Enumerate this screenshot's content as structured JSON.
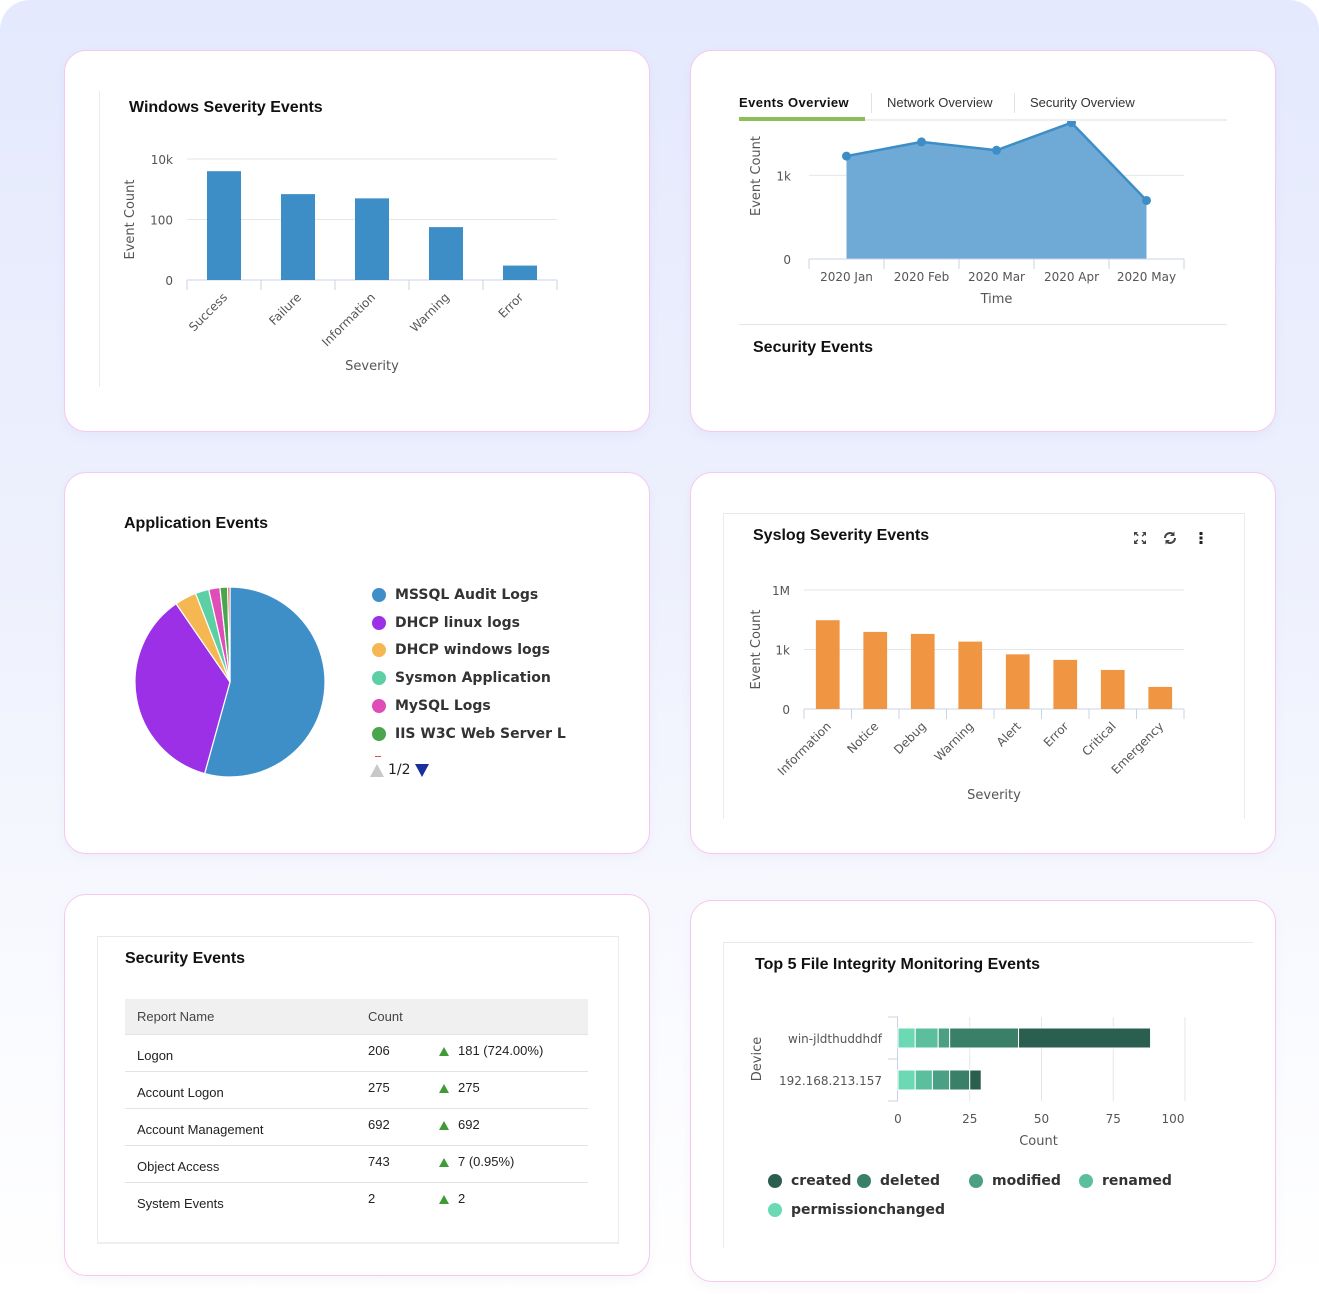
{
  "windows_severity": {
    "title": "Windows Severity Events"
  },
  "overview": {
    "tabs": [
      {
        "label": "Events Overview",
        "active": true
      },
      {
        "label": "Network Overview",
        "active": false
      },
      {
        "label": "Security Overview",
        "active": false
      }
    ],
    "accent_color": "#8cbf5a",
    "footer_title": "Security Events"
  },
  "application_events": {
    "title": "Application Events",
    "pager": {
      "label": "1/2",
      "prev_icon": "triangle-up-icon",
      "next_icon": "triangle-down-icon"
    }
  },
  "syslog_severity": {
    "title": "Syslog Severity Events",
    "toolbar": {
      "expand_icon": "expand-icon",
      "refresh_icon": "refresh-icon",
      "menu_icon": "more-vertical-icon"
    }
  },
  "security_events": {
    "title": "Security Events",
    "columns": [
      "Report Name",
      "Count",
      ""
    ],
    "rows": [
      {
        "name": "Logon",
        "count": "206",
        "change": "181 (724.00%)",
        "trend": "up"
      },
      {
        "name": "Account Logon",
        "count": "275",
        "change": "275",
        "trend": "up"
      },
      {
        "name": "Account Management",
        "count": "692",
        "change": "692",
        "trend": "up"
      },
      {
        "name": "Object Access",
        "count": "743",
        "change": "7 (0.95%)",
        "trend": "up"
      },
      {
        "name": "System Events",
        "count": "2",
        "change": "2",
        "trend": "up"
      }
    ],
    "trend_color": "#3f9b35"
  },
  "fim": {
    "title": "Top 5 File Integrity Monitoring Events"
  },
  "chart_data": [
    {
      "id": "windows",
      "type": "bar",
      "title": "Windows Severity Events",
      "xlabel": "Severity",
      "ylabel": "Event Count",
      "yscale": "log",
      "yticks": [
        {
          "value": 1,
          "label": "0"
        },
        {
          "value": 100,
          "label": "100"
        },
        {
          "value": 10000,
          "label": "10k"
        }
      ],
      "ylim": [
        1,
        10000
      ],
      "categories": [
        "Success",
        "Failure",
        "Information",
        "Warning",
        "Error"
      ],
      "values": [
        3950,
        690,
        500,
        56,
        3
      ],
      "color": "#3d8ec6",
      "grid": true
    },
    {
      "id": "events_overview",
      "type": "area",
      "xlabel": "Time",
      "ylabel": "Event Count",
      "yticks": [
        {
          "value": 0,
          "label": "0"
        },
        {
          "value": 1000,
          "label": "1k"
        }
      ],
      "ylim": [
        0,
        1650
      ],
      "categories": [
        "2020 Jan",
        "2020 Feb",
        "2020 Mar",
        "2020 Apr",
        "2020 May"
      ],
      "values": [
        1230,
        1400,
        1300,
        1630,
        700
      ],
      "color": "#3d8ec6",
      "fill": "#6fa9d6",
      "grid": true
    },
    {
      "id": "application",
      "type": "pie",
      "title": "Application Events",
      "slices": [
        {
          "label": "MSSQL Audit Logs",
          "value": 54.3,
          "color": "#3e8fc7"
        },
        {
          "label": "DHCP linux logs",
          "value": 36.1,
          "color": "#9b30e6"
        },
        {
          "label": "DHCP windows logs",
          "value": 3.7,
          "color": "#f4b752"
        },
        {
          "label": "Sysmon Application",
          "value": 2.3,
          "color": "#5ccfa5"
        },
        {
          "label": "MySQL Logs",
          "value": 1.9,
          "color": "#df4db8"
        },
        {
          "label": "IIS W3C Web Server L",
          "value": 1.3,
          "color": "#4aa64d"
        },
        {
          "label": "",
          "value": 0.4,
          "color": "#e05050"
        }
      ],
      "legend": "right",
      "legend_page": "1/2"
    },
    {
      "id": "syslog",
      "type": "bar",
      "title": "Syslog Severity Events",
      "xlabel": "Severity",
      "ylabel": "Event Count",
      "yscale": "log",
      "yticks": [
        {
          "value": 1,
          "label": "0"
        },
        {
          "value": 1000,
          "label": "1k"
        },
        {
          "value": 1000000,
          "label": "1M"
        }
      ],
      "ylim": [
        1,
        1000000
      ],
      "categories": [
        "Information",
        "Notice",
        "Debug",
        "Warning",
        "Alert",
        "Error",
        "Critical",
        "Emergency"
      ],
      "values": [
        30000,
        7700,
        6100,
        2500,
        570,
        300,
        93,
        13
      ],
      "color": "#f09643",
      "grid": true
    },
    {
      "id": "fim",
      "type": "bar",
      "orientation": "horizontal",
      "stacked": true,
      "title": "Top 5 File Integrity Monitoring Events",
      "xlabel": "Count",
      "ylabel": "Device",
      "xlim": [
        0,
        100
      ],
      "xticks": [
        0,
        25,
        50,
        75,
        100
      ],
      "categories": [
        "win-jldthuddhdf",
        "192.168.213.157"
      ],
      "series": [
        {
          "name": "permissionchanged",
          "values": [
            6,
            6
          ],
          "color": "#6cd9b5"
        },
        {
          "name": "renamed",
          "values": [
            8,
            6
          ],
          "color": "#5bbf9d"
        },
        {
          "name": "modified",
          "values": [
            4,
            6
          ],
          "color": "#4a9f85"
        },
        {
          "name": "deleted",
          "values": [
            24,
            7
          ],
          "color": "#3a7f68"
        },
        {
          "name": "created",
          "values": [
            46,
            4
          ],
          "color": "#2a5f4f"
        }
      ],
      "legend_order": [
        "created",
        "deleted",
        "modified",
        "renamed",
        "permissionchanged"
      ],
      "legend": "bottom",
      "grid": true
    }
  ]
}
